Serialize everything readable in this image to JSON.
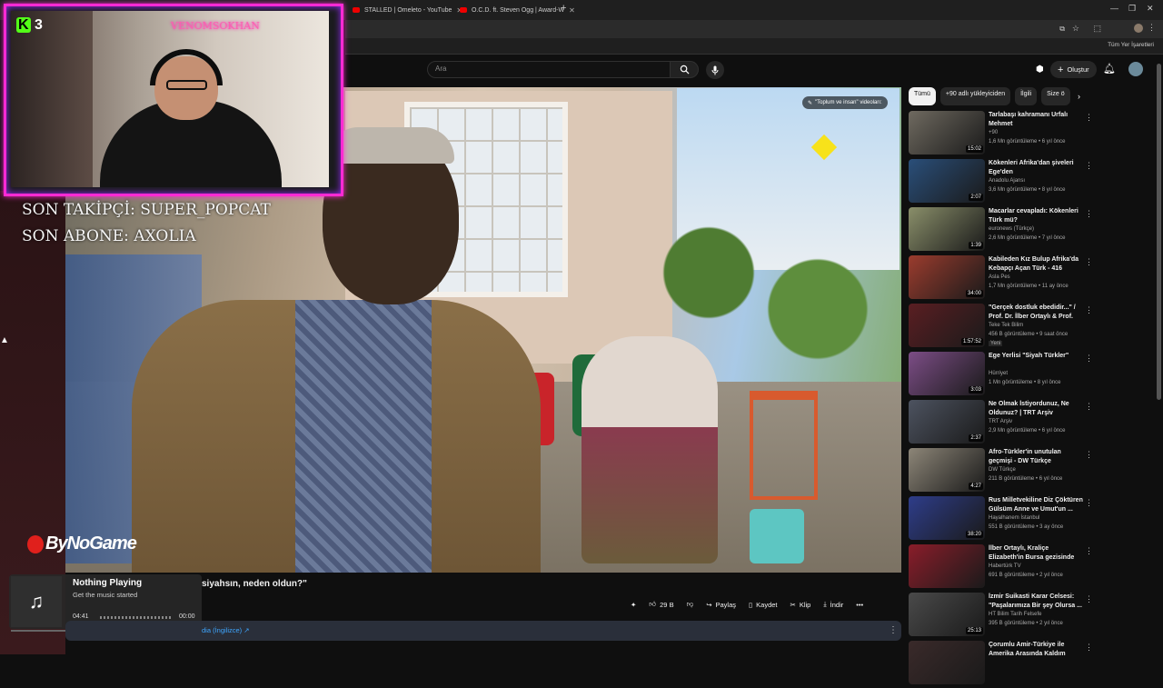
{
  "browser": {
    "tabs": [
      {
        "label": "STALLED | Omeleto - YouTube"
      },
      {
        "label": "O.C.D. ft. Steven Ogg | Award-W"
      }
    ],
    "new_tab": "+",
    "bookmarks_all": "Tüm Yer İşaretleri"
  },
  "youtube": {
    "search_placeholder": "Ara",
    "create_label": "Oluştur",
    "video_title": "siyahsın, neden oldun?\"",
    "overlay_chip": "\"Toplum ve insan\" videoları:",
    "actions": {
      "likes": "29 B",
      "share": "Paylaş",
      "save": "Kaydet",
      "clip": "Klip",
      "download": "İndir"
    },
    "desc_link": "dia (İngilizce) ↗"
  },
  "stream_overlay": {
    "platform_count": "3",
    "cam_name": "VENOMSOKHAN",
    "last_follower": "SON TAKİPÇİ: SUPER_POPCAT",
    "last_subscriber": "SON ABONE: AXOLIA",
    "channel_logo": "ByNoGame",
    "music": {
      "title": "Nothing Playing",
      "subtitle": "Get the music started",
      "time_start": "04:41",
      "time_end": "00:00"
    }
  },
  "chips": [
    {
      "label": "Tümü"
    },
    {
      "label": "+90 adlı yükleyiciden"
    },
    {
      "label": "İlgili"
    },
    {
      "label": "Size ö"
    }
  ],
  "recommendations": [
    {
      "title": "Tarlabaşı kahramanı Urfalı Mehmet",
      "channel": "+90",
      "meta": "1,6 Mn görüntüleme • 6 yıl önce",
      "duration": "15:02",
      "color": "#6f6a60"
    },
    {
      "title": "Kökenleri Afrika'dan şiveleri Ege'den",
      "channel": "Anadolu Ajansı",
      "meta": "3,6 Mn görüntüleme • 8 yıl önce",
      "duration": "2:07",
      "color": "#2a4f7a"
    },
    {
      "title": "Macarlar cevapladı: Kökenleri Türk mü?",
      "channel": "euronews (Türkçe)",
      "meta": "2,6 Mn görüntüleme • 7 yıl önce",
      "duration": "1:39",
      "color": "#8a8f6a"
    },
    {
      "title": "Kabileden Kız Bulup Afrika'da Kebapçı Açan Türk - 416",
      "channel": "Asla Pes",
      "meta": "1,7 Mn görüntüleme • 11 ay önce",
      "duration": "34:00",
      "color": "#9b3c2e"
    },
    {
      "title": "\"Gerçek dostluk ebedidir...\" / Prof. Dr. İlber Ortaylı & Prof. Dr...",
      "channel": "Teke Tek Bilim",
      "meta": "456 B görüntüleme • 9 saat önce",
      "duration": "1:57:52",
      "new": "Yeni",
      "color": "#5a1e22"
    },
    {
      "title": "Ege Yerlisi \"Siyah Türkler\"",
      "channel": "Hürriyet",
      "meta": "1 Mn görüntüleme • 8 yıl önce",
      "duration": "3:03",
      "color": "#7c4d86"
    },
    {
      "title": "Ne Olmak İstiyordunuz, Ne Oldunuz? | TRT Arşiv",
      "channel": "TRT Arşiv",
      "meta": "2,9 Mn görüntüleme • 6 yıl önce",
      "duration": "2:37",
      "color": "#4d5360"
    },
    {
      "title": "Afro-Türkler'in unutulan geçmişi - DW Türkçe",
      "channel": "DW Türkçe",
      "meta": "211 B görüntüleme • 6 yıl önce",
      "duration": "4:27",
      "color": "#8d8678"
    },
    {
      "title": "Rus Milletvekiline Diz Çöktüren Gülsüm Anne ve Umut'un ...",
      "channel": "Hayalhanem İstanbul",
      "meta": "551 B görüntüleme • 3 ay önce",
      "duration": "38:20",
      "color": "#2e3d8a"
    },
    {
      "title": "İlber Ortaylı, Kraliçe Elizabeth'in Bursa gezisinde yaşanan bir ...",
      "channel": "Habertürk TV",
      "meta": "691 B görüntüleme • 2 yıl önce",
      "duration": "",
      "color": "#8a1d2a"
    },
    {
      "title": "İzmir Suikasti Karar Celsesi: \"Paşalarımıza Bir şey Olursa ...",
      "channel": "HT Bilim Tarih Felsefe",
      "meta": "395 B görüntüleme • 2 yıl önce",
      "duration": "25:13",
      "color": "#4a4a4a"
    },
    {
      "title": "Çorumlu Amir-Türkiye ile Amerika Arasında Kaldım",
      "channel": "",
      "meta": "",
      "duration": "",
      "color": "#3a2a2a"
    }
  ]
}
